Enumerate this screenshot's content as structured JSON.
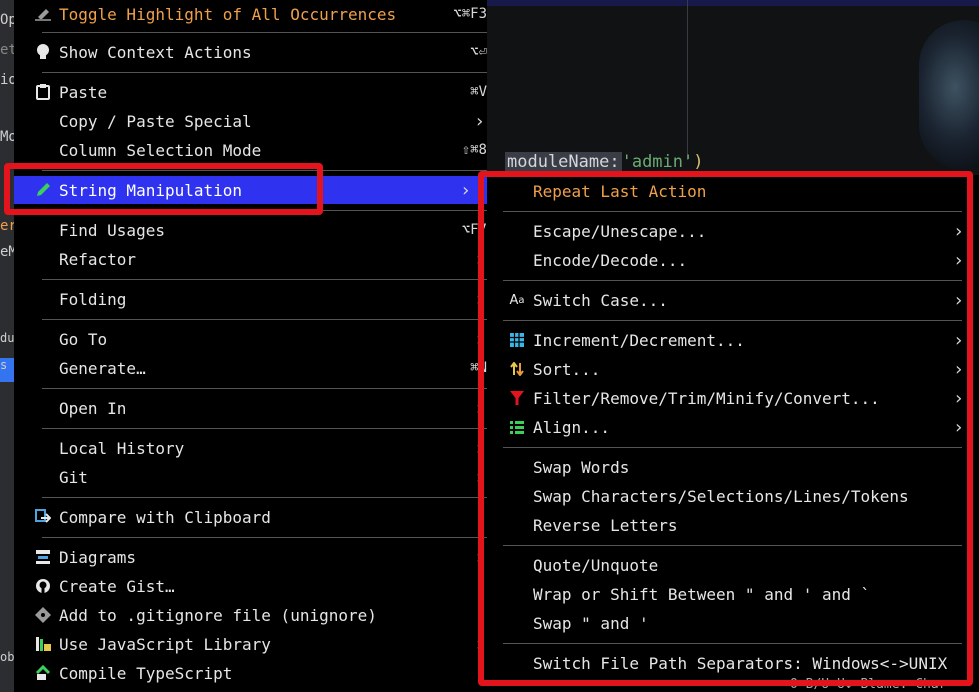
{
  "editor": {
    "code_keyword": "moduleName:",
    "code_string": "'admin'",
    "code_paren": ")",
    "gutter_fragments": [
      "Op",
      "et",
      "io",
      "Mo",
      "er",
      "eM",
      "du",
      "s",
      "ob"
    ],
    "status_fragment": "O B/U U↕  Blame: Char"
  },
  "context_menu": {
    "items": [
      {
        "id": "toggle-highlight",
        "label": "Toggle Highlight of All Occurrences",
        "shortcut": "⌥⌘F3",
        "icon": "highlighter-icon"
      },
      {
        "id": "show-context-actions",
        "label": "Show Context Actions",
        "shortcut": "⌥⏎",
        "icon": "lightbulb-icon"
      },
      {
        "id": "paste",
        "label": "Paste",
        "shortcut": "⌘V",
        "icon": "clipboard-icon"
      },
      {
        "id": "copy-paste-special",
        "label": "Copy / Paste Special",
        "submenu": true
      },
      {
        "id": "column-selection-mode",
        "label": "Column Selection Mode",
        "shortcut": "⇧⌘8"
      },
      {
        "id": "string-manipulation",
        "label": "String Manipulation",
        "submenu": true,
        "icon": "pencil-icon",
        "selected": true
      },
      {
        "id": "find-usages",
        "label": "Find Usages",
        "shortcut": "⌥F7"
      },
      {
        "id": "refactor",
        "label": "Refactor",
        "submenu": true
      },
      {
        "id": "folding",
        "label": "Folding",
        "submenu": true
      },
      {
        "id": "go-to",
        "label": "Go To",
        "submenu": true
      },
      {
        "id": "generate",
        "label": "Generate…",
        "shortcut": "⌘N"
      },
      {
        "id": "open-in",
        "label": "Open In",
        "submenu": true
      },
      {
        "id": "local-history",
        "label": "Local History",
        "submenu": true
      },
      {
        "id": "git",
        "label": "Git",
        "submenu": true
      },
      {
        "id": "compare-with-clipboard",
        "label": "Compare with Clipboard",
        "icon": "compare-icon"
      },
      {
        "id": "diagrams",
        "label": "Diagrams",
        "submenu": true,
        "icon": "diagram-icon"
      },
      {
        "id": "create-gist",
        "label": "Create Gist…",
        "icon": "github-icon"
      },
      {
        "id": "add-to-gitignore",
        "label": "Add to .gitignore file (unignore)",
        "icon": "gitignore-icon"
      },
      {
        "id": "use-js-library",
        "label": "Use JavaScript Library",
        "submenu": true,
        "icon": "js-library-icon"
      },
      {
        "id": "compile-typescript",
        "label": "Compile TypeScript",
        "icon": "typescript-icon"
      }
    ]
  },
  "submenu": {
    "items": [
      {
        "id": "repeat-last-action",
        "label": "Repeat Last Action"
      },
      {
        "id": "escape-unescape",
        "label": "Escape/Unescape...",
        "submenu": true
      },
      {
        "id": "encode-decode",
        "label": "Encode/Decode...",
        "submenu": true
      },
      {
        "id": "switch-case",
        "label": "Switch Case...",
        "submenu": true,
        "icon": "switch-case-icon"
      },
      {
        "id": "increment-decrement",
        "label": "Increment/Decrement...",
        "submenu": true,
        "icon": "calculator-icon"
      },
      {
        "id": "sort",
        "label": "Sort...",
        "submenu": true,
        "icon": "sort-icon"
      },
      {
        "id": "filter-remove",
        "label": "Filter/Remove/Trim/Minify/Convert...",
        "submenu": true,
        "icon": "filter-icon"
      },
      {
        "id": "align",
        "label": "Align...",
        "submenu": true,
        "icon": "align-icon"
      },
      {
        "id": "swap-words",
        "label": "Swap Words"
      },
      {
        "id": "swap-chars",
        "label": "Swap Characters/Selections/Lines/Tokens"
      },
      {
        "id": "reverse-letters",
        "label": "Reverse Letters"
      },
      {
        "id": "quote-unquote",
        "label": "Quote/Unquote"
      },
      {
        "id": "wrap-or-shift",
        "label": "Wrap or Shift Between \" and ' and `"
      },
      {
        "id": "swap-quotes",
        "label": "Swap \" and '"
      },
      {
        "id": "switch-path-separators",
        "label": "Switch File Path Separators: Windows<->UNIX"
      }
    ]
  },
  "colors": {
    "menu_bg": "#000000",
    "selection": "#2f33f0",
    "accent_orange": "#f0a04b",
    "annotation_red": "#e4141c"
  }
}
